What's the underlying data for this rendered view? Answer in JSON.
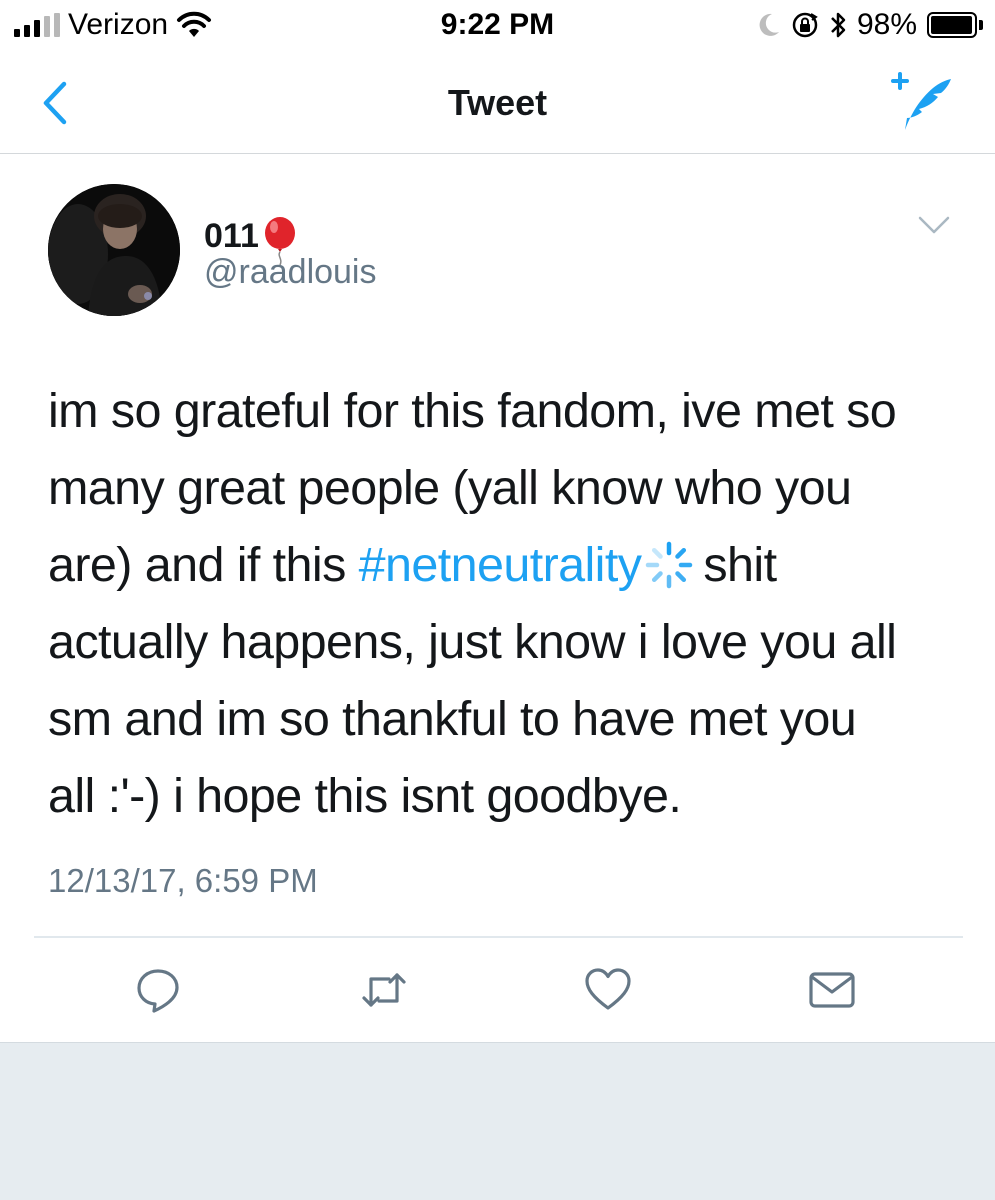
{
  "status_bar": {
    "carrier": "Verizon",
    "time": "9:22 PM",
    "battery_text": "98%",
    "battery_level": 0.98,
    "icons": [
      "signal-icon",
      "wifi-icon",
      "moon-icon",
      "rotation-lock-icon",
      "bluetooth-icon",
      "battery-icon"
    ]
  },
  "nav": {
    "title": "Tweet",
    "back_icon": "chevron-left-icon",
    "compose_icon": "compose-tweet-icon",
    "accent_color": "#1da1f2"
  },
  "tweet": {
    "display_name": "011",
    "name_emoji": "balloon-emoji",
    "handle": "@raadlouis",
    "text_lines": {
      "l1": "im so grateful for this fandom, ive met so",
      "l2": "many great people (yall know who you",
      "l3_before": "are) and if this ",
      "l3_hashtag": "#netneutrality",
      "l3_after": "shit",
      "l4": "actually happens, just know i love you all",
      "l5": "sm and im so thankful to have met you",
      "l6": "all :'-) i hope this isnt goodbye."
    },
    "hashtag_emoji": "loading-spinner-icon",
    "timestamp": "12/13/17, 6:59 PM"
  },
  "actions": [
    {
      "name": "reply-icon"
    },
    {
      "name": "retweet-icon"
    },
    {
      "name": "like-icon"
    },
    {
      "name": "direct-message-icon"
    }
  ],
  "colors": {
    "text": "#14171a",
    "secondary": "#657786",
    "link": "#1da1f2",
    "footer_bg": "#e6ecf0"
  }
}
